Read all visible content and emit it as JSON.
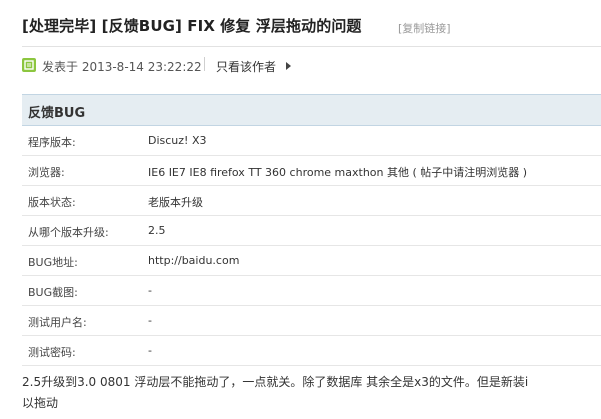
{
  "thread": {
    "title": "[处理完毕] [反馈BUG] FIX 修复 浮层拖动的问题",
    "copy_link": "[复制链接]",
    "posted_at": "发表于 2013-8-14 23:22:22",
    "only_author": "只看该作者"
  },
  "bug_table": {
    "header": "反馈BUG",
    "rows": [
      {
        "key": "程序版本:",
        "value": "Discuz! X3"
      },
      {
        "key": "浏览器:",
        "value": "IE6 IE7 IE8 firefox TT 360 chrome maxthon 其他 ( 帖子中请注明浏览器 )"
      },
      {
        "key": "版本状态:",
        "value": "老版本升级"
      },
      {
        "key": "从哪个版本升级:",
        "value": "2.5"
      },
      {
        "key": "BUG地址:",
        "value": "http://baidu.com"
      },
      {
        "key": "BUG截图:",
        "value": "-"
      },
      {
        "key": "测试用户名:",
        "value": "-"
      },
      {
        "key": "测试密码:",
        "value": "-"
      }
    ]
  },
  "post_body": {
    "line1": "2.5升级到3.0 0801 浮动层不能拖动了，一点就关。除了数据库 其余全是x3的文件。但是新装i",
    "line2": "以拖动"
  },
  "icons": {
    "post_status": "post-status-icon",
    "arrow": "arrow-right-icon"
  },
  "colors": {
    "table_header_bg": "#e5edf2",
    "icon_green": "#8cc63f"
  }
}
